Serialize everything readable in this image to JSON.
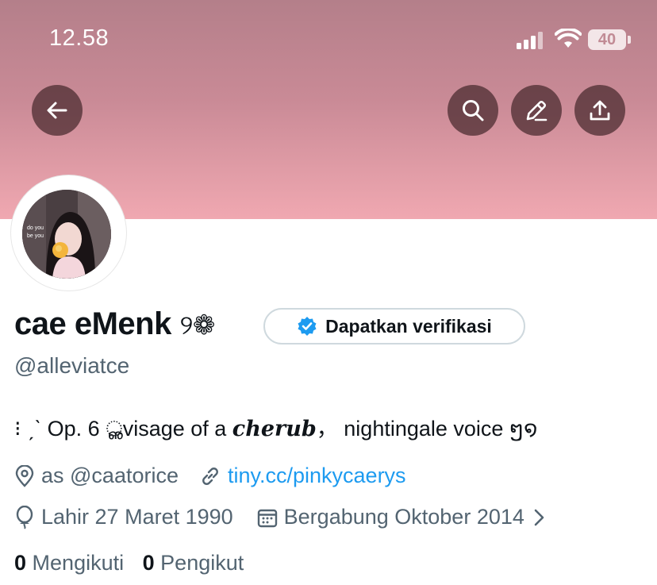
{
  "status_bar": {
    "time": "12.58",
    "battery": "40"
  },
  "header": {
    "back_icon": "arrow-left-icon",
    "search_icon": "search-icon",
    "edit_icon": "pencil-icon",
    "share_icon": "upload-icon"
  },
  "profile": {
    "name": "cae eMenk",
    "name_suffix": "୨❁",
    "verify_button_label": "Dapatkan verifikasi",
    "handle": "@alleviatce",
    "bio": {
      "part1": "⁝ ˏˋ Op. 6 ",
      "part2": "ൢvisage of a ",
      "part3_bold_italic": "cherub",
      "part4": "，  nightingale voice  ໆ໑"
    },
    "location": "as @caatorice",
    "website": "tiny.cc/pinkycaerys",
    "birthday": "Lahir 27 Maret 1990",
    "joined": "Bergabung Oktober 2014",
    "following_count": "0",
    "following_label": "Mengikuti",
    "followers_count": "0",
    "followers_label": "Pengikut"
  },
  "colors": {
    "banner_top": "#b47f8a",
    "banner_bottom": "#f0a8b1",
    "link": "#1d9bf0",
    "verify_badge": "#1d9bf0",
    "secondary_text": "#536471"
  }
}
